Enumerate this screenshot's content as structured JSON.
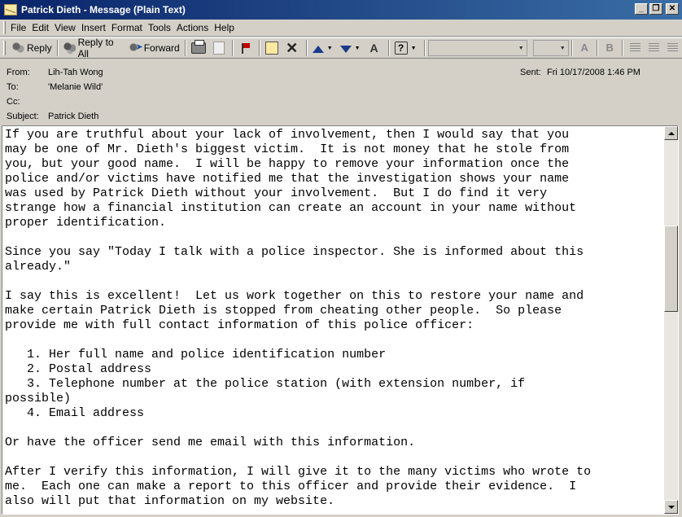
{
  "window": {
    "title": "Patrick Dieth - Message (Plain Text)",
    "minimize_glyph": "_",
    "restore_glyph": "❐",
    "close_glyph": "✕"
  },
  "menu": {
    "items": [
      {
        "label": "File"
      },
      {
        "label": "Edit"
      },
      {
        "label": "View"
      },
      {
        "label": "Insert"
      },
      {
        "label": "Format"
      },
      {
        "label": "Tools"
      },
      {
        "label": "Actions"
      },
      {
        "label": "Help"
      }
    ]
  },
  "toolbar": {
    "reply_label": "Reply",
    "reply_all_label": "Reply to All",
    "forward_label": "Forward",
    "font_glyph": "A",
    "bold_glyph": "B"
  },
  "header": {
    "from_label": "From:",
    "from_value": "Lih-Tah Wong",
    "to_label": "To:",
    "to_value": "'Melanie Wild'",
    "cc_label": "Cc:",
    "cc_value": "",
    "subject_label": "Subject:",
    "subject_value": "Patrick Dieth",
    "sent_label": "Sent:",
    "sent_value": "Fri 10/17/2008 1:46 PM"
  },
  "message": {
    "body": "If you are truthful about your lack of involvement, then I would say that you\nmay be one of Mr. Dieth's biggest victim.  It is not money that he stole from\nyou, but your good name.  I will be happy to remove your information once the\npolice and/or victims have notified me that the investigation shows your name\nwas used by Patrick Dieth without your involvement.  But I do find it very\nstrange how a financial institution can create an account in your name without\nproper identification.\n\nSince you say \"Today I talk with a police inspector. She is informed about this\nalready.\"\n\nI say this is excellent!  Let us work together on this to restore your name and\nmake certain Patrick Dieth is stopped from cheating other people.  So please\nprovide me with full contact information of this police officer:\n\n   1. Her full name and police identification number\n   2. Postal address\n   3. Telephone number at the police station (with extension number, if\npossible)\n   4. Email address\n\nOr have the officer send me email with this information.\n\nAfter I verify this information, I will give it to the many victims who wrote to\nme.  Each one can make a report to this officer and provide their evidence.  I\nalso will put that information on my website."
  }
}
